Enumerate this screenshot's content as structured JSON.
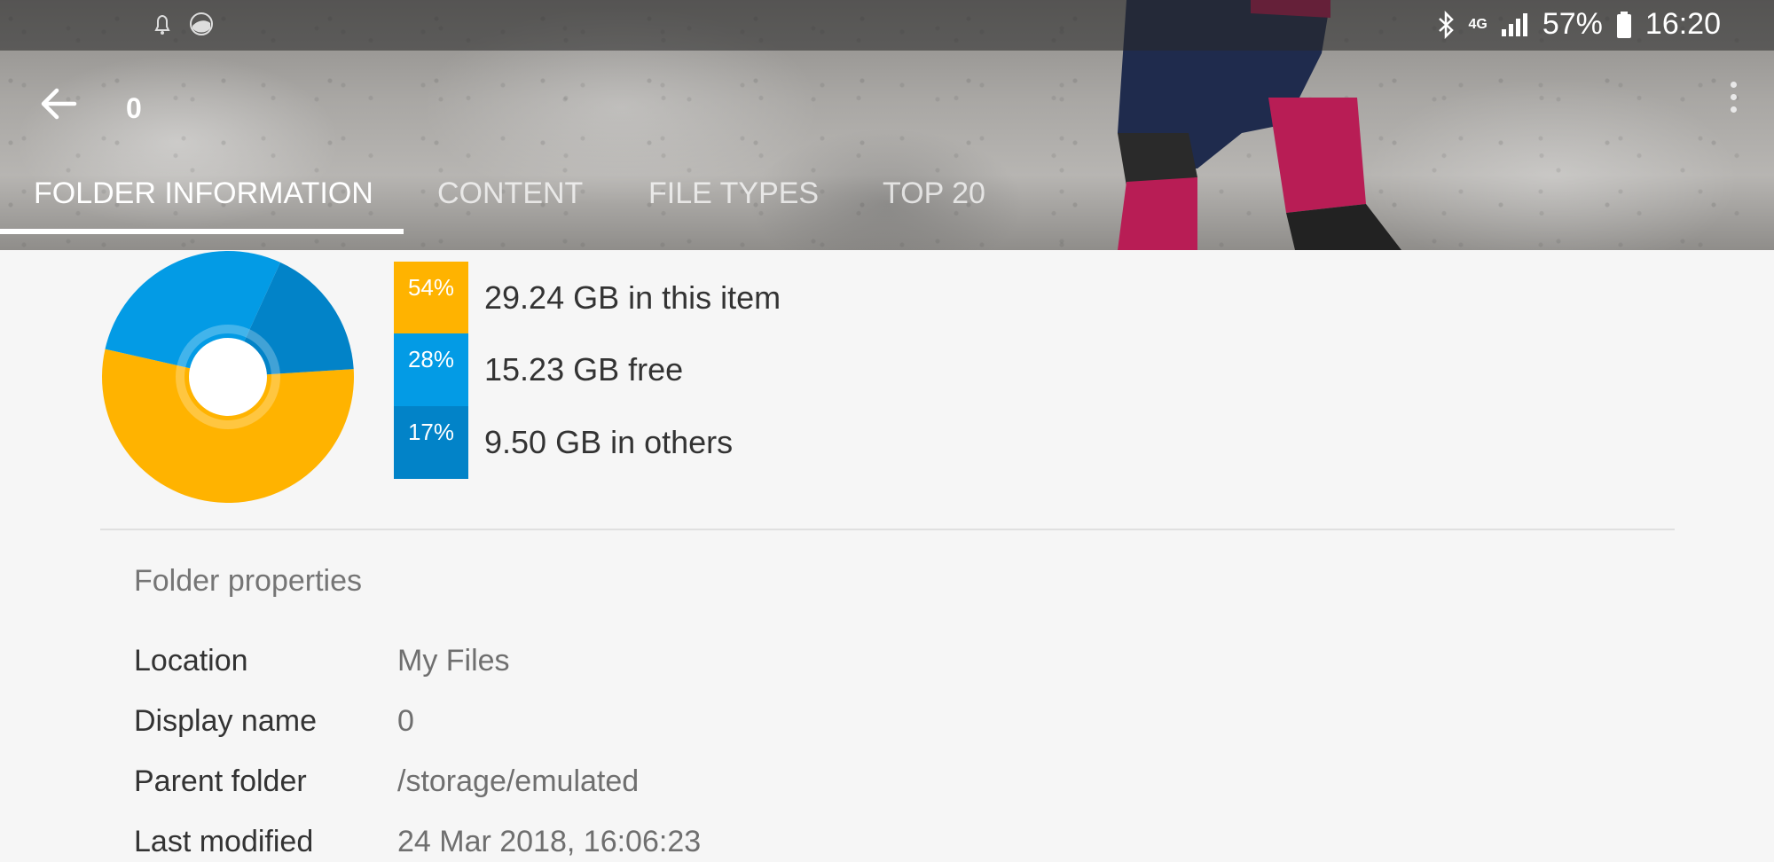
{
  "status_bar": {
    "battery": "57%",
    "time": "16:20",
    "network": "4G",
    "icons_left": [
      "notification-bell-icon",
      "app-notification-icon"
    ],
    "icons_right": [
      "bluetooth-icon",
      "network-4g-icon",
      "signal-icon",
      "battery-icon"
    ]
  },
  "app_bar": {
    "title": "0",
    "back_icon": "arrow-left-icon",
    "menu_icon": "more-vertical-icon"
  },
  "tabs": [
    {
      "label": "FOLDER INFORMATION",
      "active": true
    },
    {
      "label": "CONTENT",
      "active": false
    },
    {
      "label": "FILE TYPES",
      "active": false
    },
    {
      "label": "TOP 20",
      "active": false
    }
  ],
  "usage": {
    "colors": {
      "item": "#ffb300",
      "free": "#039be5",
      "others": "#0283c8"
    },
    "items": [
      {
        "percent_label": "54%",
        "text": "29.24 GB in this item",
        "value": 54
      },
      {
        "percent_label": "28%",
        "text": "15.23 GB free",
        "value": 28
      },
      {
        "percent_label": "17%",
        "text": "9.50 GB in others",
        "value": 17
      }
    ]
  },
  "properties": {
    "title": "Folder properties",
    "rows": [
      {
        "label": "Location",
        "value": "My Files"
      },
      {
        "label": "Display name",
        "value": "0"
      },
      {
        "label": "Parent folder",
        "value": "/storage/emulated"
      },
      {
        "label": "Last modified",
        "value": "24 Mar 2018, 16:06:23"
      }
    ]
  }
}
